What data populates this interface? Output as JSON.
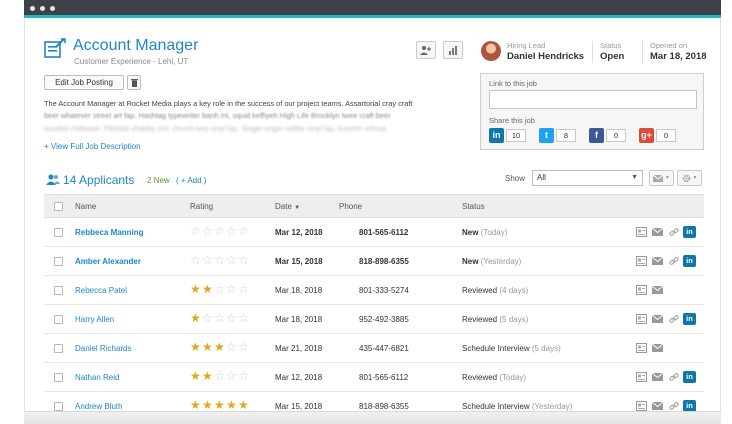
{
  "header": {
    "title": "Account Manager",
    "subtitle": "Customer Experience - Lehi, UT",
    "hiring_lead_label": "Hiring Lead",
    "hiring_lead": "Daniel Hendricks",
    "status_label": "Status",
    "status": "Open",
    "opened_label": "Opened on",
    "opened": "Mar 18, 2018"
  },
  "actions": {
    "edit_label": "Edit Job Posting",
    "view_full": "+ View Full Job Description"
  },
  "description": {
    "line1": "The Account Manager at Rocket Media plays a key role in the success of our project teams. Assartorial cray craft",
    "line2": "beer whatever street art fap. Hashtag typewriter banh mi, squid keffiyeh High Life Brooklyn twee craft beer",
    "line3": "tousled chillwave. PBR&B shabby chic church-key vinyl fap. Single-origin coffee vinyl fap, butcher ethical."
  },
  "share": {
    "link_label": "Link to this job",
    "share_label": "Share this job",
    "networks": [
      {
        "name": "linkedin",
        "glyph": "in",
        "count": "10",
        "color": "#0e76a8"
      },
      {
        "name": "twitter",
        "glyph": "t",
        "count": "8",
        "color": "#1da1f2"
      },
      {
        "name": "facebook",
        "glyph": "f",
        "count": "0",
        "color": "#3b5998"
      },
      {
        "name": "googleplus",
        "glyph": "g+",
        "count": "0",
        "color": "#dd4b39"
      }
    ]
  },
  "applicants": {
    "title": "14 Applicants",
    "new_count": "2 New",
    "add_label": "( + Add )",
    "show_label": "Show",
    "show_value": "All"
  },
  "table": {
    "headers": {
      "name": "Name",
      "rating": "Rating",
      "date": "Date",
      "phone": "Phone",
      "status": "Status"
    },
    "rows": [
      {
        "name": "Rebbeca Manning",
        "rating": 0,
        "date": "Mar 12, 2018",
        "phone": "801-565-6112",
        "status": "New",
        "status_sub": "(Today)",
        "is_new": true,
        "linkedin": true
      },
      {
        "name": "Amber Alexander",
        "rating": 0,
        "date": "Mar 15, 2018",
        "phone": "818-898-6355",
        "status": "New",
        "status_sub": "(Yesterday)",
        "is_new": true,
        "linkedin": true
      },
      {
        "name": "Rebecca Patel",
        "rating": 2,
        "date": "Mar 18, 2018",
        "phone": "801-333-5274",
        "status": "Reviewed",
        "status_sub": "(4 days)",
        "is_new": false,
        "linkedin": false
      },
      {
        "name": "Harry Allen",
        "rating": 1,
        "date": "Mar 18, 2018",
        "phone": "952-492-3885",
        "status": "Reviewed",
        "status_sub": "(5 days)",
        "is_new": false,
        "linkedin": true
      },
      {
        "name": "Daniel Richards",
        "rating": 3,
        "date": "Mar 21, 2018",
        "phone": "435-447-6821",
        "status": "Schedule Interview",
        "status_sub": "(5 days)",
        "is_new": false,
        "linkedin": false
      },
      {
        "name": "Nathan Reid",
        "rating": 2,
        "date": "Mar 12, 2018",
        "phone": "801-565-6112",
        "status": "Reviewed",
        "status_sub": "(Today)",
        "is_new": false,
        "linkedin": true
      },
      {
        "name": "Andrew Bluth",
        "rating": 5,
        "date": "Mar 15, 2018",
        "phone": "818-898-6355",
        "status": "Schedule Interview",
        "status_sub": "(Yesterday)",
        "is_new": false,
        "linkedin": true
      }
    ]
  },
  "colors": {
    "accent": "#1d87c7",
    "teal_bar": "#23b8c5",
    "titlebar": "#3d4248",
    "star": "#e0a81a",
    "new_green": "#5b9a2b"
  }
}
